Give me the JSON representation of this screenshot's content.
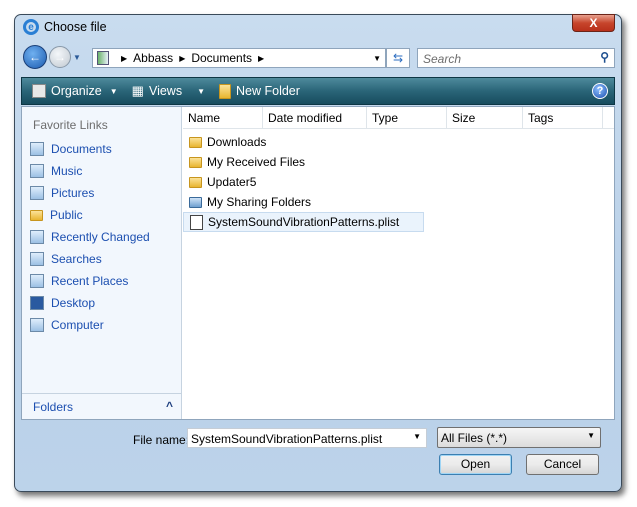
{
  "window": {
    "title": "Choose file",
    "close": "X"
  },
  "address": {
    "path": [
      "Abbass",
      "Documents"
    ],
    "search_placeholder": "Search"
  },
  "toolbar": {
    "organize": "Organize",
    "views": "Views",
    "new_folder": "New Folder",
    "help": "?"
  },
  "sidebar": {
    "heading": "Favorite Links",
    "items": [
      {
        "label": "Documents"
      },
      {
        "label": "Music"
      },
      {
        "label": "Pictures"
      },
      {
        "label": "Public"
      },
      {
        "label": "Recently Changed"
      },
      {
        "label": "Searches"
      },
      {
        "label": "Recent Places"
      },
      {
        "label": "Desktop"
      },
      {
        "label": "Computer"
      }
    ],
    "folders": "Folders"
  },
  "columns": [
    "Name",
    "Date modified",
    "Type",
    "Size",
    "Tags"
  ],
  "files": [
    {
      "name": "Downloads",
      "kind": "folder"
    },
    {
      "name": "My Received Files",
      "kind": "folder"
    },
    {
      "name": "Updater5",
      "kind": "folder"
    },
    {
      "name": "My Sharing Folders",
      "kind": "shared"
    },
    {
      "name": "SystemSoundVibrationPatterns.plist",
      "kind": "file",
      "selected": true
    }
  ],
  "bottom": {
    "file_name_label": "File name:",
    "file_name": "SystemSoundVibrationPatterns.plist",
    "file_type": "All Files (*.*)",
    "open": "Open",
    "cancel": "Cancel"
  }
}
